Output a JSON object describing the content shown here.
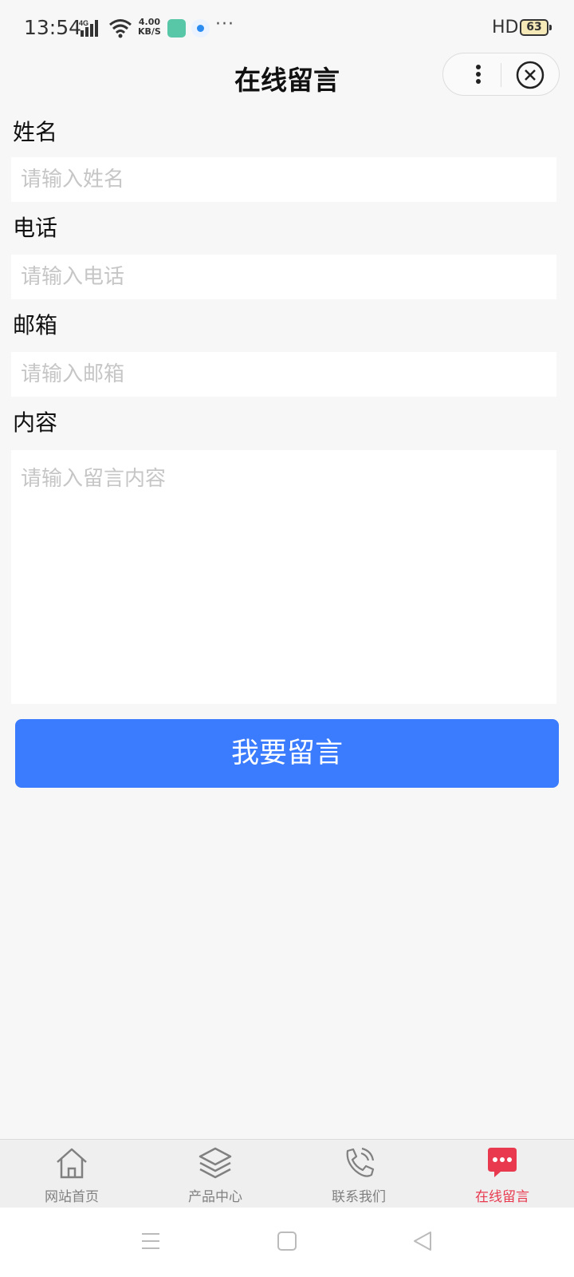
{
  "status_bar": {
    "time": "13:54",
    "network": "4G",
    "speed_value": "4.00",
    "speed_unit": "KB/S",
    "more": "···",
    "hd": "HD",
    "battery": "63"
  },
  "nav": {
    "title": "在线留言"
  },
  "form": {
    "name": {
      "label": "姓名",
      "placeholder": "请输入姓名"
    },
    "phone": {
      "label": "电话",
      "placeholder": "请输入电话"
    },
    "email": {
      "label": "邮箱",
      "placeholder": "请输入邮箱"
    },
    "content": {
      "label": "内容",
      "placeholder": "请输入留言内容"
    },
    "submit_label": "我要留言"
  },
  "tabbar": {
    "items": [
      {
        "label": "网站首页",
        "icon": "home-icon",
        "active": false
      },
      {
        "label": "产品中心",
        "icon": "layers-icon",
        "active": false
      },
      {
        "label": "联系我们",
        "icon": "phone-icon",
        "active": false
      },
      {
        "label": "在线留言",
        "icon": "message-icon",
        "active": true
      }
    ]
  },
  "colors": {
    "primary": "#3b7bfd",
    "active_tab": "#e8394f",
    "placeholder": "#c6c6c6",
    "background": "#f7f7f7"
  }
}
